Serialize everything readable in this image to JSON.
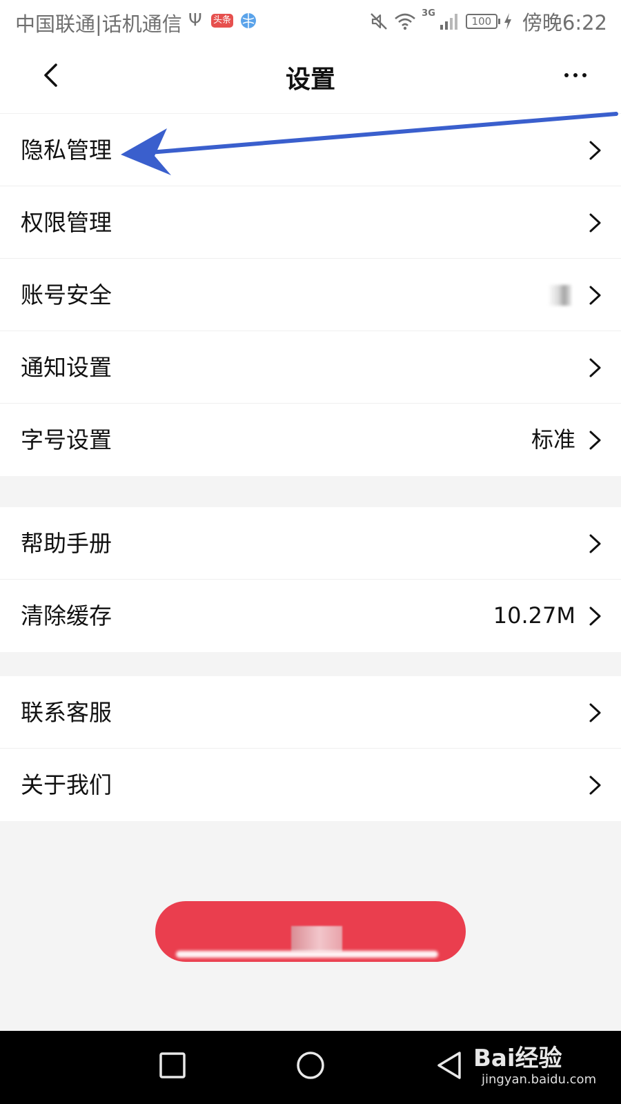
{
  "status_bar": {
    "carrier": "中国联通|话机通信",
    "news_badge": "头条",
    "network_type": "3G",
    "battery": "100",
    "time": "傍晚6:22",
    "icons": [
      "usb-icon",
      "news-app-icon",
      "browser-icon",
      "mute-icon",
      "wifi-icon",
      "signal-icon",
      "charging-icon"
    ]
  },
  "nav": {
    "title": "设置",
    "back_icon": "chevron-left-icon",
    "more_icon": "more-dots-icon"
  },
  "groups": [
    {
      "items": [
        {
          "label": "隐私管理",
          "value": ""
        },
        {
          "label": "权限管理",
          "value": ""
        },
        {
          "label": "账号安全",
          "value": ""
        },
        {
          "label": "通知设置",
          "value": ""
        },
        {
          "label": "字号设置",
          "value": "标准"
        }
      ]
    },
    {
      "items": [
        {
          "label": "帮助手册",
          "value": ""
        },
        {
          "label": "清除缓存",
          "value": "10.27M"
        }
      ]
    },
    {
      "items": [
        {
          "label": "联系客服",
          "value": ""
        },
        {
          "label": "关于我们",
          "value": ""
        }
      ]
    }
  ],
  "logout_button": {
    "label": ""
  },
  "annotation": {
    "color": "#3a5fcd",
    "target": "隐私管理"
  },
  "system_nav": {
    "icons": [
      "recent-apps-icon",
      "home-icon",
      "back-icon"
    ]
  },
  "watermark": {
    "main": "Bai经验",
    "sub": "jingyan.baidu.com"
  },
  "colors": {
    "page_background": "#f4f4f4",
    "row_background": "#ffffff",
    "logout_button": "#ea3e4e",
    "system_nav_background": "#000000"
  }
}
